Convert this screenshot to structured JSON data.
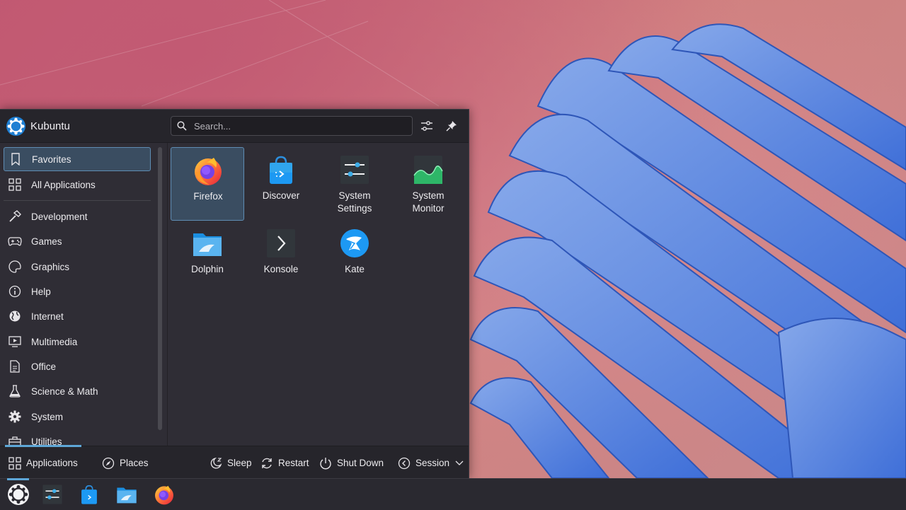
{
  "launcher": {
    "brand": "Kubuntu",
    "search": {
      "placeholder": "Search..."
    },
    "header_buttons": [
      "configure-icon",
      "pin-icon"
    ]
  },
  "sidebar": {
    "items": [
      {
        "label": "Favorites",
        "icon": "bookmark-icon",
        "active": true
      },
      {
        "label": "All Applications",
        "icon": "grid-icon"
      },
      {
        "label": "Development",
        "icon": "hammer-icon"
      },
      {
        "label": "Games",
        "icon": "gamepad-icon"
      },
      {
        "label": "Graphics",
        "icon": "palette-icon"
      },
      {
        "label": "Help",
        "icon": "info-icon"
      },
      {
        "label": "Internet",
        "icon": "globe-icon"
      },
      {
        "label": "Multimedia",
        "icon": "media-icon"
      },
      {
        "label": "Office",
        "icon": "document-icon"
      },
      {
        "label": "Science & Math",
        "icon": "flask-icon"
      },
      {
        "label": "System",
        "icon": "gear-icon"
      },
      {
        "label": "Utilities",
        "icon": "toolbox-icon"
      }
    ]
  },
  "apps": [
    {
      "label": "Firefox",
      "icon": "firefox-icon",
      "active": true
    },
    {
      "label": "Discover",
      "icon": "discover-icon"
    },
    {
      "label": "System\nSettings",
      "icon": "system-settings-icon"
    },
    {
      "label": "System\nMonitor",
      "icon": "system-monitor-icon"
    },
    {
      "label": "Dolphin",
      "icon": "dolphin-icon"
    },
    {
      "label": "Konsole",
      "icon": "konsole-icon"
    },
    {
      "label": "Kate",
      "icon": "kate-icon"
    }
  ],
  "footer": {
    "tabs": [
      {
        "label": "Applications",
        "icon": "grid-icon",
        "active": true
      },
      {
        "label": "Places",
        "icon": "compass-icon"
      }
    ],
    "actions": [
      {
        "label": "Sleep",
        "icon": "sleep-icon"
      },
      {
        "label": "Restart",
        "icon": "restart-icon"
      },
      {
        "label": "Shut Down",
        "icon": "power-icon"
      },
      {
        "label": "Session",
        "icon": "session-icon"
      }
    ]
  },
  "taskbar": {
    "items": [
      "kubuntu-launcher-icon",
      "system-settings-icon",
      "discover-icon",
      "dolphin-icon",
      "firefox-icon"
    ]
  },
  "colors": {
    "accent": "#5ea7d8",
    "selection": "#3a4d61",
    "panel": "#2f2d35"
  }
}
